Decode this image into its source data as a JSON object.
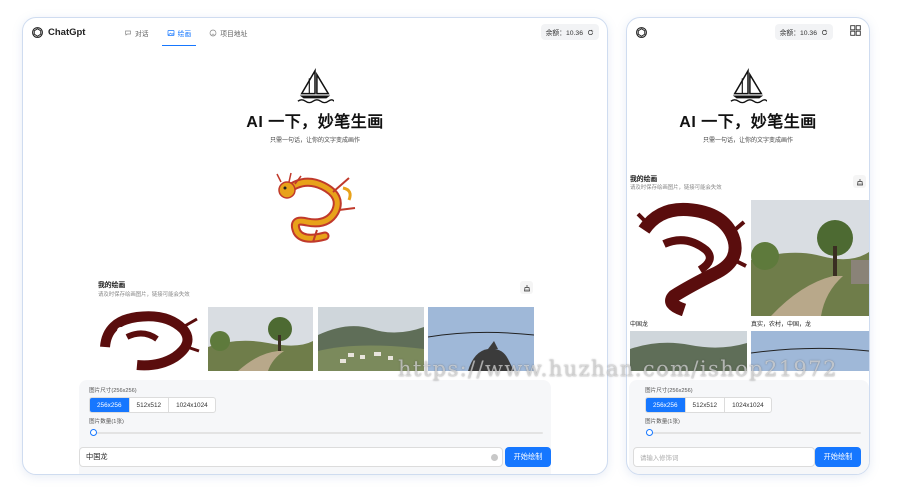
{
  "app": {
    "brand": "ChatGpt"
  },
  "nav": {
    "tabs": [
      {
        "label": "对话",
        "icon": "chat-icon",
        "active": false
      },
      {
        "label": "绘画",
        "icon": "image-icon",
        "active": true
      },
      {
        "label": "项目地址",
        "icon": "github-icon",
        "active": false
      }
    ]
  },
  "balance": {
    "text": "余额：10.36"
  },
  "hero": {
    "title": "AI 一下，妙笔生画",
    "subtitle": "只需一句话，让你的文字变成画作"
  },
  "gallery": {
    "title": "我的绘画",
    "tip": "请及时保存绘画图片，链接可能会失效",
    "items": [
      {
        "caption": "中国龙",
        "kind": "dragon-silhouette"
      },
      {
        "caption": "真实，农村，中国，龙",
        "kind": "village-road"
      },
      {
        "caption": "",
        "kind": "mountain-village"
      },
      {
        "caption": "",
        "kind": "sky-dragon"
      }
    ]
  },
  "controls": {
    "size_label": "图片尺寸(256x256)",
    "sizes": [
      "256x256",
      "512x512",
      "1024x1024"
    ],
    "selected_size": "256x256",
    "count_label": "图片数量(1张)",
    "count_value": 1,
    "desktop_prompt_value": "中国龙",
    "mobile_prompt_placeholder": "请输入修饰词",
    "submit_label": "开始绘制"
  },
  "watermark": "https://www.huzhan.com/ishop21972",
  "colors": {
    "accent": "#1677ff",
    "dragon_gold": "#e8a21a",
    "dragon_red": "#c0392b",
    "silhouette": "#5a0d0d"
  }
}
